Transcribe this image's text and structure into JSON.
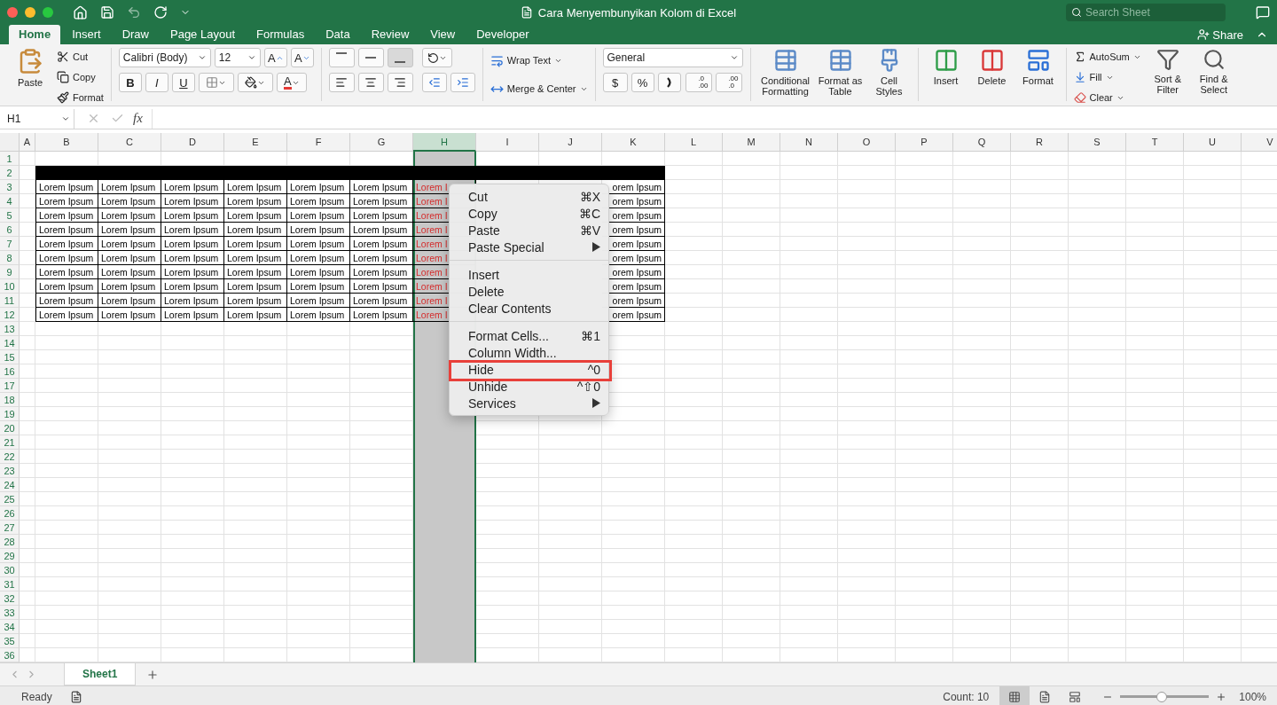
{
  "window": {
    "title": "Cara Menyembunyikan Kolom di Excel"
  },
  "search": {
    "placeholder": "Search Sheet"
  },
  "tabs": [
    {
      "label": "Home",
      "selected": true
    },
    {
      "label": "Insert",
      "selected": false
    },
    {
      "label": "Draw",
      "selected": false
    },
    {
      "label": "Page Layout",
      "selected": false
    },
    {
      "label": "Formulas",
      "selected": false
    },
    {
      "label": "Data",
      "selected": false
    },
    {
      "label": "Review",
      "selected": false
    },
    {
      "label": "View",
      "selected": false
    },
    {
      "label": "Developer",
      "selected": false
    }
  ],
  "share": {
    "label": "Share"
  },
  "ribbon": {
    "clipboard": {
      "paste": "Paste",
      "items": [
        "Cut",
        "Copy",
        "Format"
      ]
    },
    "font": {
      "name": "Calibri (Body)",
      "size": "12",
      "grow": "A",
      "shrink": "A",
      "styles": [
        "B",
        "I",
        "U"
      ],
      "color_letter": "A"
    },
    "alignment": {
      "vertical": [
        {
          "selected": false
        },
        {
          "selected": false
        },
        {
          "selected": true
        }
      ]
    },
    "merge": [
      "Wrap Text",
      "Merge & Center"
    ],
    "number": {
      "format": "General",
      "currency": "$",
      "percent": "%",
      "decimals": [
        {
          "top": ".0",
          "bottom": ".00"
        },
        {
          "top": ".00",
          "bottom": ".0"
        }
      ]
    },
    "styles": [
      "Conditional Formatting",
      "Format as Table",
      "Cell Styles"
    ],
    "cells": [
      "Insert",
      "Delete",
      "Format"
    ],
    "editing": {
      "small": [
        "AutoSum",
        "Fill",
        "Clear"
      ],
      "big": [
        "Sort & Filter",
        "Find & Select"
      ]
    }
  },
  "formula_bar": {
    "name_box": "H1",
    "fx": "fx"
  },
  "grid": {
    "columns": [
      {
        "letter": "A",
        "selected": false
      },
      {
        "letter": "B",
        "selected": false
      },
      {
        "letter": "C",
        "selected": false
      },
      {
        "letter": "D",
        "selected": false
      },
      {
        "letter": "E",
        "selected": false
      },
      {
        "letter": "F",
        "selected": false
      },
      {
        "letter": "G",
        "selected": false
      },
      {
        "letter": "H",
        "selected": true,
        "color": "#d42a2a"
      },
      {
        "letter": "I",
        "selected": false
      },
      {
        "letter": "J",
        "selected": false
      },
      {
        "letter": "K",
        "selected": false
      },
      {
        "letter": "L",
        "selected": false
      },
      {
        "letter": "M",
        "selected": false
      },
      {
        "letter": "N",
        "selected": false
      },
      {
        "letter": "O",
        "selected": false
      },
      {
        "letter": "P",
        "selected": false
      },
      {
        "letter": "Q",
        "selected": false
      },
      {
        "letter": "R",
        "selected": false
      },
      {
        "letter": "S",
        "selected": false
      },
      {
        "letter": "T",
        "selected": false
      },
      {
        "letter": "U",
        "selected": false
      },
      {
        "letter": "V",
        "selected": false
      }
    ],
    "rows": [
      {
        "number": "1",
        "kind": "empty"
      },
      {
        "number": "2",
        "kind": "band"
      },
      {
        "number": "3",
        "kind": "data",
        "cells": [
          "Lorem Ipsum",
          "Lorem Ipsum",
          "Lorem Ipsum",
          "Lorem Ipsum",
          "Lorem Ipsum",
          "Lorem Ipsum",
          "Lorem I",
          null,
          null,
          "orem Ipsum"
        ]
      },
      {
        "number": "4",
        "kind": "data",
        "cells": [
          "Lorem Ipsum",
          "Lorem Ipsum",
          "Lorem Ipsum",
          "Lorem Ipsum",
          "Lorem Ipsum",
          "Lorem Ipsum",
          "Lorem I",
          null,
          null,
          "orem Ipsum"
        ]
      },
      {
        "number": "5",
        "kind": "data",
        "cells": [
          "Lorem Ipsum",
          "Lorem Ipsum",
          "Lorem Ipsum",
          "Lorem Ipsum",
          "Lorem Ipsum",
          "Lorem Ipsum",
          "Lorem I",
          null,
          null,
          "orem Ipsum"
        ]
      },
      {
        "number": "6",
        "kind": "data",
        "cells": [
          "Lorem Ipsum",
          "Lorem Ipsum",
          "Lorem Ipsum",
          "Lorem Ipsum",
          "Lorem Ipsum",
          "Lorem Ipsum",
          "Lorem I",
          null,
          null,
          "orem Ipsum"
        ]
      },
      {
        "number": "7",
        "kind": "data",
        "cells": [
          "Lorem Ipsum",
          "Lorem Ipsum",
          "Lorem Ipsum",
          "Lorem Ipsum",
          "Lorem Ipsum",
          "Lorem Ipsum",
          "Lorem I",
          null,
          null,
          "orem Ipsum"
        ]
      },
      {
        "number": "8",
        "kind": "data",
        "cells": [
          "Lorem Ipsum",
          "Lorem Ipsum",
          "Lorem Ipsum",
          "Lorem Ipsum",
          "Lorem Ipsum",
          "Lorem Ipsum",
          "Lorem I",
          null,
          null,
          "orem Ipsum"
        ]
      },
      {
        "number": "9",
        "kind": "data",
        "cells": [
          "Lorem Ipsum",
          "Lorem Ipsum",
          "Lorem Ipsum",
          "Lorem Ipsum",
          "Lorem Ipsum",
          "Lorem Ipsum",
          "Lorem I",
          null,
          null,
          "orem Ipsum"
        ]
      },
      {
        "number": "10",
        "kind": "data",
        "cells": [
          "Lorem Ipsum",
          "Lorem Ipsum",
          "Lorem Ipsum",
          "Lorem Ipsum",
          "Lorem Ipsum",
          "Lorem Ipsum",
          "Lorem I",
          null,
          null,
          "orem Ipsum"
        ]
      },
      {
        "number": "11",
        "kind": "data",
        "cells": [
          "Lorem Ipsum",
          "Lorem Ipsum",
          "Lorem Ipsum",
          "Lorem Ipsum",
          "Lorem Ipsum",
          "Lorem Ipsum",
          "Lorem I",
          null,
          null,
          "orem Ipsum"
        ]
      },
      {
        "number": "12",
        "kind": "data",
        "cells": [
          "Lorem Ipsum",
          "Lorem Ipsum",
          "Lorem Ipsum",
          "Lorem Ipsum",
          "Lorem Ipsum",
          "Lorem Ipsum",
          "Lorem I",
          null,
          null,
          "orem Ipsum"
        ]
      },
      {
        "number": "13",
        "kind": "empty"
      },
      {
        "number": "14",
        "kind": "empty"
      },
      {
        "number": "15",
        "kind": "empty"
      },
      {
        "number": "16",
        "kind": "empty"
      },
      {
        "number": "17",
        "kind": "empty"
      },
      {
        "number": "18",
        "kind": "empty"
      },
      {
        "number": "19",
        "kind": "empty"
      },
      {
        "number": "20",
        "kind": "empty"
      },
      {
        "number": "21",
        "kind": "empty"
      },
      {
        "number": "22",
        "kind": "empty"
      },
      {
        "number": "23",
        "kind": "empty"
      },
      {
        "number": "24",
        "kind": "empty"
      },
      {
        "number": "25",
        "kind": "empty"
      },
      {
        "number": "26",
        "kind": "empty"
      },
      {
        "number": "27",
        "kind": "empty"
      },
      {
        "number": "28",
        "kind": "empty"
      },
      {
        "number": "29",
        "kind": "empty"
      },
      {
        "number": "30",
        "kind": "empty"
      },
      {
        "number": "31",
        "kind": "empty"
      },
      {
        "number": "32",
        "kind": "empty"
      },
      {
        "number": "33",
        "kind": "empty"
      },
      {
        "number": "34",
        "kind": "empty"
      },
      {
        "number": "35",
        "kind": "empty"
      },
      {
        "number": "36",
        "kind": "empty"
      }
    ]
  },
  "context_menu": {
    "groups": [
      [
        {
          "label": "Cut",
          "shortcut": "⌘X",
          "submenu": false,
          "annotated": false
        },
        {
          "label": "Copy",
          "shortcut": "⌘C",
          "submenu": false,
          "annotated": false
        },
        {
          "label": "Paste",
          "shortcut": "⌘V",
          "submenu": false,
          "annotated": false
        },
        {
          "label": "Paste Special",
          "submenu": true,
          "annotated": false
        }
      ],
      [
        {
          "label": "Insert",
          "submenu": false,
          "annotated": false
        },
        {
          "label": "Delete",
          "submenu": false,
          "annotated": false
        },
        {
          "label": "Clear Contents",
          "submenu": false,
          "annotated": false
        }
      ],
      [
        {
          "label": "Format Cells...",
          "shortcut": "⌘1",
          "submenu": false,
          "annotated": false
        },
        {
          "label": "Column Width...",
          "submenu": false,
          "annotated": false
        },
        {
          "label": "Hide",
          "shortcut": "^0",
          "submenu": false,
          "annotated": true
        },
        {
          "label": "Unhide",
          "shortcut": "^⇧0",
          "submenu": false,
          "annotated": false
        },
        {
          "label": "Services",
          "submenu": true,
          "annotated": false
        }
      ]
    ]
  },
  "sheet_tabs": [
    {
      "label": "Sheet1",
      "selected": true
    }
  ],
  "status_bar": {
    "mode": "Ready",
    "count": "Count: 10",
    "views": [
      {
        "selected": true
      },
      {
        "selected": false
      },
      {
        "selected": false
      }
    ],
    "zoom": {
      "level": 0.47,
      "reading": "100%"
    }
  }
}
